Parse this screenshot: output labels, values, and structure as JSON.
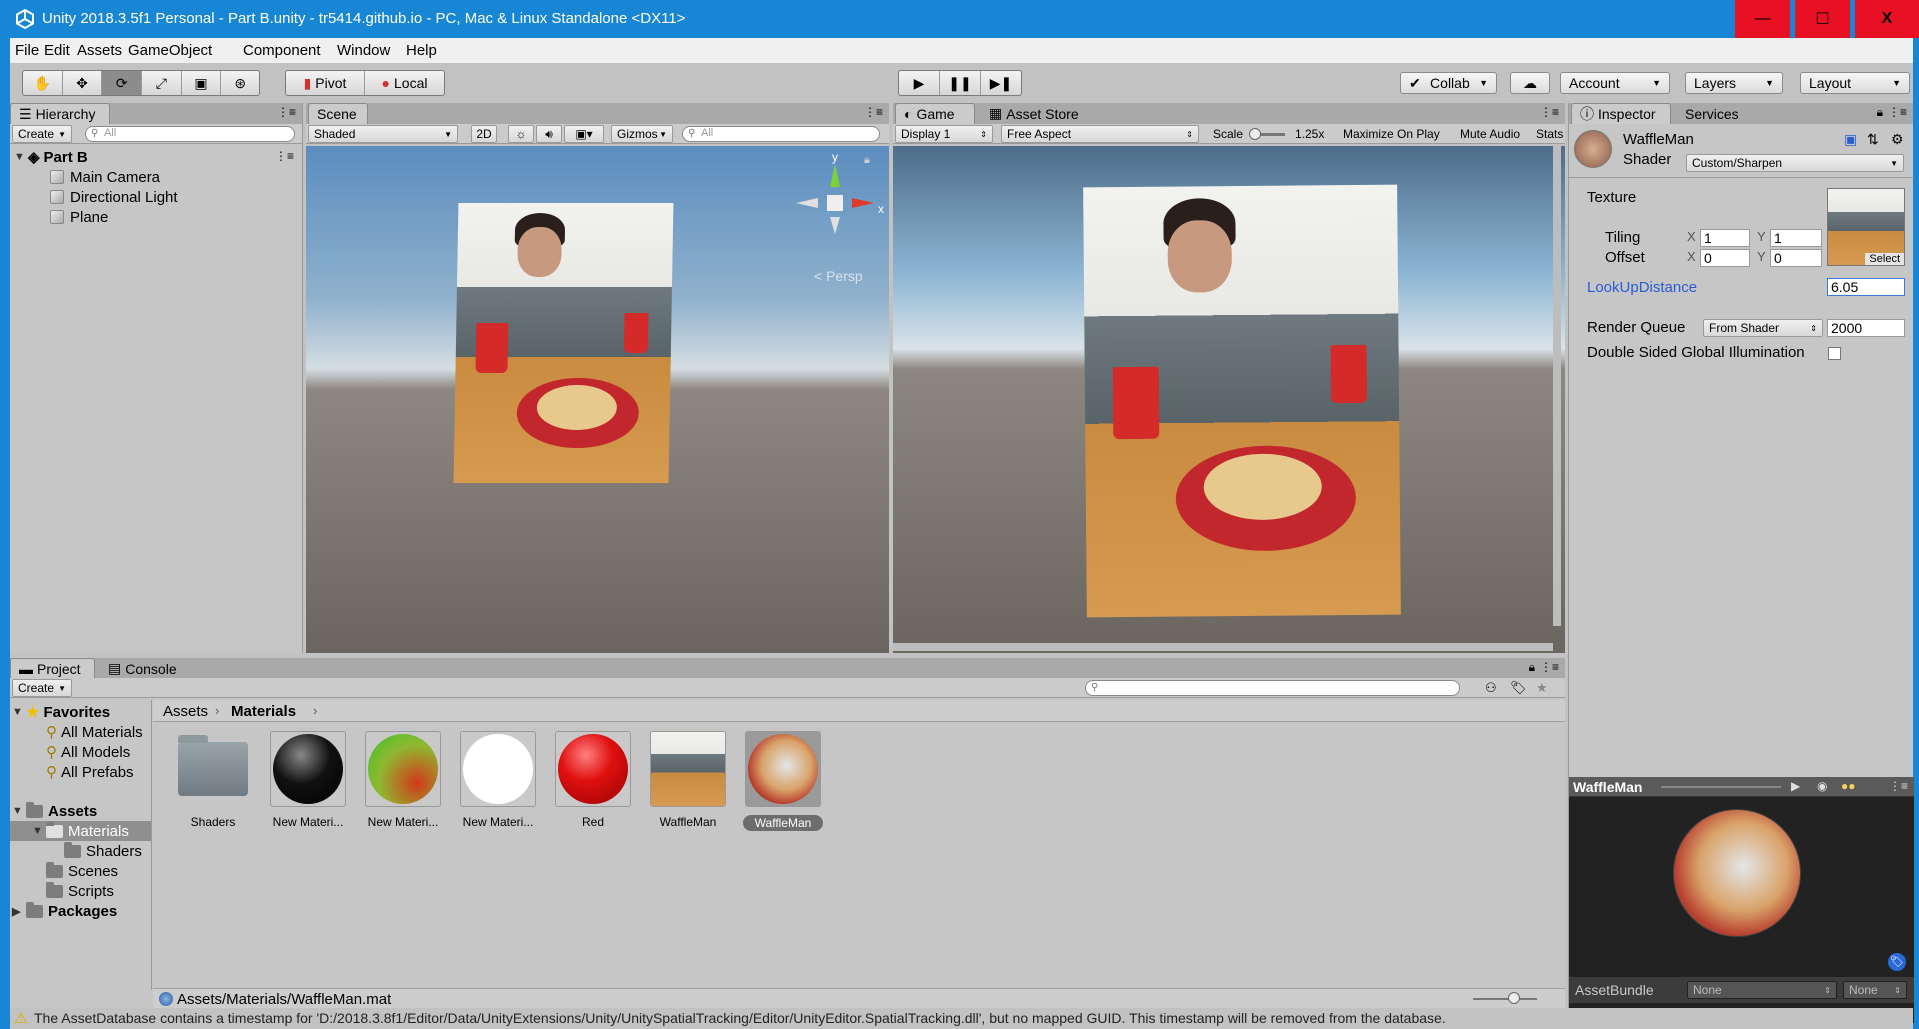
{
  "window": {
    "title": "Unity 2018.3.5f1 Personal - Part B.unity - tr5414.github.io - PC, Mac & Linux Standalone <DX11>",
    "minimize": "—",
    "maximize": "☐",
    "close": "X"
  },
  "menu": [
    "File",
    "Edit",
    "Assets",
    "GameObject",
    "Component",
    "Window",
    "Help"
  ],
  "toolbar": {
    "pivot": "Pivot",
    "local": "Local",
    "collab": "Collab",
    "account": "Account",
    "layers": "Layers",
    "layout": "Layout"
  },
  "hierarchy": {
    "tab": "Hierarchy",
    "create": "Create",
    "search_placeholder": "All",
    "scene_name": "Part B",
    "items": [
      "Main Camera",
      "Directional Light",
      "Plane"
    ]
  },
  "scene": {
    "tab": "Scene",
    "shading": "Shaded",
    "mode_2d": "2D",
    "gizmos": "Gizmos",
    "search_placeholder": "All",
    "persp": "Persp",
    "axis_y": "y",
    "axis_x": "x"
  },
  "game": {
    "tabs": [
      "Game",
      "Asset Store"
    ],
    "display": "Display 1",
    "aspect": "Free Aspect",
    "scale_label": "Scale",
    "scale_value": "1.25x",
    "maximize": "Maximize On Play",
    "mute": "Mute Audio",
    "stats": "Stats"
  },
  "inspector": {
    "tabs": [
      "Inspector",
      "Services"
    ],
    "material_name": "WaffleMan",
    "shader_label": "Shader",
    "shader_value": "Custom/Sharpen",
    "texture_label": "Texture",
    "tiling_label": "Tiling",
    "offset_label": "Offset",
    "tiling_x": "1",
    "tiling_y": "1",
    "offset_x": "0",
    "offset_y": "0",
    "x_label": "X",
    "y_label": "Y",
    "select": "Select",
    "lookup_label": "LookUpDistance",
    "lookup_value": "6.05",
    "render_queue_label": "Render Queue",
    "render_queue_mode": "From Shader",
    "render_queue_value": "2000",
    "double_sided_label": "Double Sided Global Illumination",
    "preview_title": "WaffleMan",
    "assetbundle_label": "AssetBundle",
    "assetbundle_value": "None",
    "assetbundle_variant": "None"
  },
  "project": {
    "tabs": [
      "Project",
      "Console"
    ],
    "create": "Create",
    "favorites": "Favorites",
    "favorite_items": [
      "All Materials",
      "All Models",
      "All Prefabs"
    ],
    "assets_root": "Assets",
    "tree": [
      "Materials",
      "Shaders",
      "Scenes",
      "Scripts"
    ],
    "packages": "Packages",
    "breadcrumb_root": "Assets",
    "breadcrumb_current": "Materials",
    "assets": [
      "Shaders",
      "New Materi...",
      "New Materi...",
      "New Materi...",
      "Red",
      "WaffleMan",
      "WaffleMan"
    ],
    "selected_path": "Assets/Materials/WaffleMan.mat"
  },
  "status": {
    "message": "The AssetDatabase contains a timestamp for 'D:/2018.3.8f1/Editor/Data/UnityExtensions/Unity/UnitySpatialTracking/Editor/UnityEditor.SpatialTracking.dll', but no mapped GUID. This timestamp will be removed from the database."
  },
  "colors": {
    "titlebar": "#1786d4",
    "editor_bg": "#c2c2c2",
    "link_blue": "#2a5cd6",
    "warning": "#f0c000"
  }
}
